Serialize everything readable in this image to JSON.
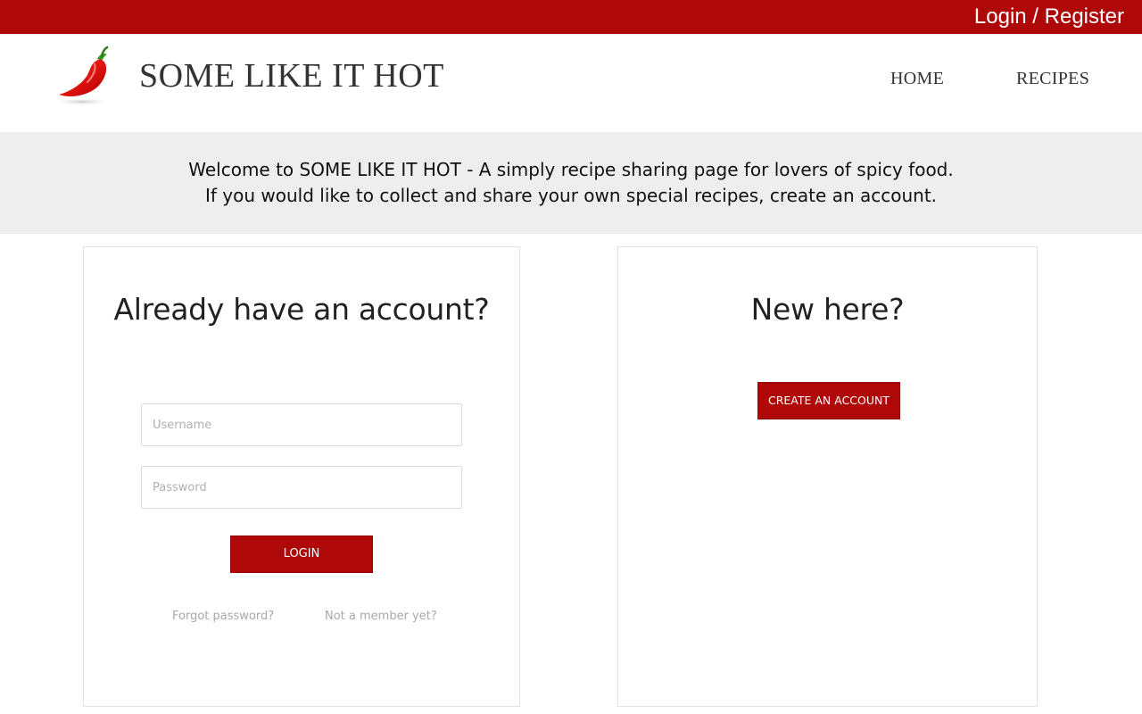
{
  "topbar": {
    "auth_link": "Login / Register",
    "color": "#af0808"
  },
  "header": {
    "brand": "SOME LIKE IT HOT",
    "logo_icon": "chili-pepper-icon",
    "nav": [
      {
        "label": "HOME"
      },
      {
        "label": "RECIPES"
      }
    ]
  },
  "welcome": {
    "line1": "Welcome to SOME LIKE IT HOT - A simply recipe sharing page for lovers of spicy food.",
    "line2": "If you would like to collect and share your own special recipes, create an account."
  },
  "login_card": {
    "title": "Already have an account?",
    "username_placeholder": "Username",
    "username_value": "",
    "password_placeholder": "Password",
    "password_value": "",
    "login_button": "LOGIN",
    "forgot_link": "Forgot password?",
    "member_link": "Not a member yet?"
  },
  "new_card": {
    "title": "New here?",
    "create_button": "CREATE AN ACCOUNT"
  }
}
